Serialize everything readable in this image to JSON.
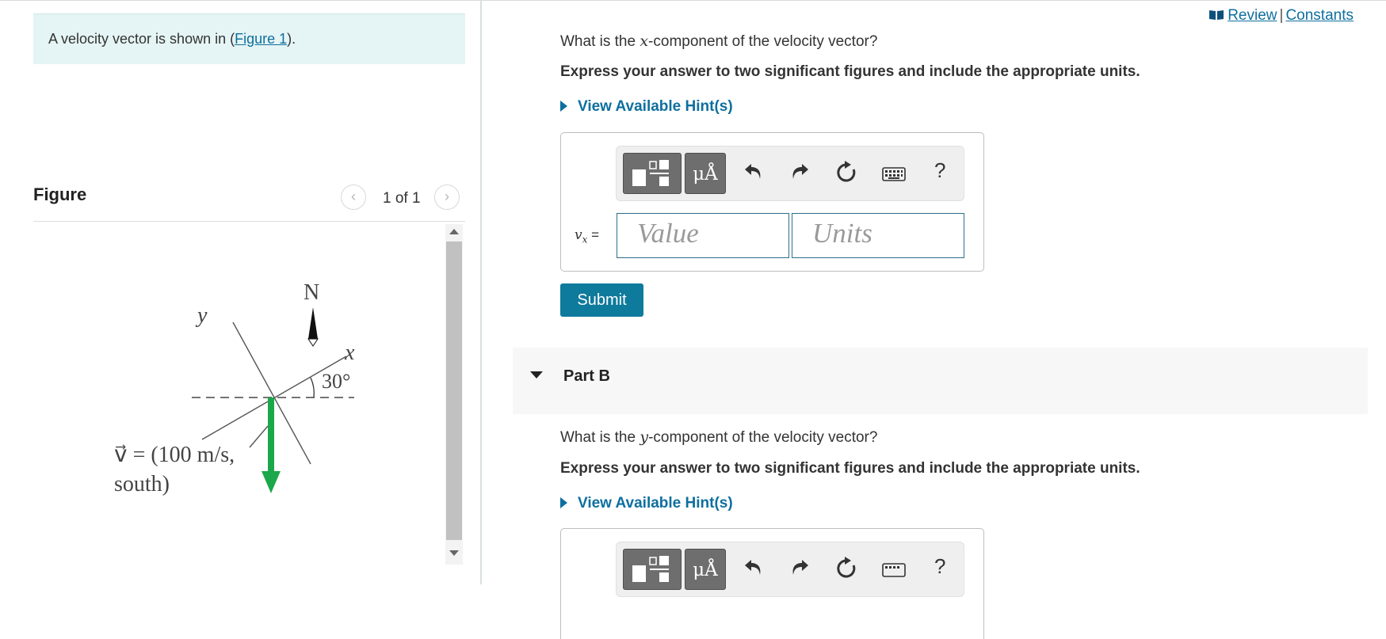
{
  "left_pane": {
    "intro": {
      "prefix": "A velocity vector is shown in (",
      "link": "Figure 1",
      "suffix": ")."
    },
    "figure_heading": "Figure",
    "pager": {
      "text": "1 of 1",
      "prev_icon": "chevron-left-icon",
      "next_icon": "chevron-right-icon"
    },
    "diagram": {
      "label_n": "N",
      "label_y": "y",
      "label_x": "x",
      "angle": "30°",
      "vector_line1": "v⃗ = (100 m/s,",
      "vector_line2": "south)",
      "vector_color": "#1aa84a"
    }
  },
  "header_links": {
    "icon": "book-icon",
    "review": "Review",
    "separator": "|",
    "constants": "Constants"
  },
  "part_a": {
    "question_prefix": "What is the ",
    "question_var": "x",
    "question_suffix": "-component of the velocity vector?",
    "instruction": "Express your answer to two significant figures and include the appropriate units.",
    "hint": "View Available Hint(s)",
    "toolbar": {
      "templates_icon": "templates-icon",
      "units_label": "μÅ",
      "undo_icon": "undo-icon",
      "redo_icon": "redo-icon",
      "reset_icon": "reset-icon",
      "keyboard_icon": "keyboard-icon",
      "help": "?"
    },
    "var_symbol": "v",
    "var_sub": "x",
    "var_eq": "=",
    "value_placeholder": "Value",
    "units_placeholder": "Units",
    "submit": "Submit"
  },
  "part_b": {
    "label": "Part B",
    "question_prefix": "What is the ",
    "question_var": "y",
    "question_suffix": "-component of the velocity vector?",
    "instruction": "Express your answer to two significant figures and include the appropriate units.",
    "hint": "View Available Hint(s)",
    "toolbar": {
      "units_label": "μÅ",
      "help": "?"
    }
  },
  "colors": {
    "link": "#0e6f9f",
    "intro_background": "#e5f4f4",
    "submit_background": "#0e7a9c"
  }
}
